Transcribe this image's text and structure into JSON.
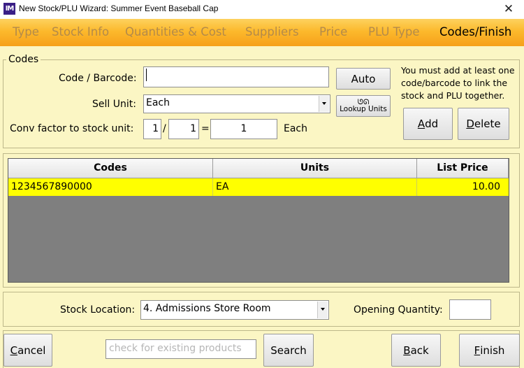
{
  "window": {
    "app_icon": "IM",
    "title": "New Stock/PLU Wizard: Summer Event Baseball Cap",
    "close_glyph": "✕"
  },
  "tabs": [
    {
      "label": "Type",
      "active": false
    },
    {
      "label": "Stock Info",
      "active": false
    },
    {
      "label": "Quantities & Cost",
      "active": false
    },
    {
      "label": "Suppliers",
      "active": false
    },
    {
      "label": "Price",
      "active": false
    },
    {
      "label": "PLU Type",
      "active": false
    },
    {
      "label": "Codes/Finish",
      "active": true
    }
  ],
  "codes": {
    "legend": "Codes",
    "barcode_label": "Code / Barcode:",
    "barcode_value": "",
    "sell_unit_label": "Sell Unit:",
    "sell_unit_value": "Each",
    "conv_label": "Conv factor to stock unit:",
    "conv_num": "1",
    "conv_slash": "/",
    "conv_den": "1",
    "conv_equals": "=",
    "conv_result": "1",
    "conv_unit": "Each",
    "auto_button": "Auto",
    "lookup_units_icon": "glasses-icon",
    "lookup_units_glyph": "ᘎᘏ",
    "lookup_units_button": "Lookup Units",
    "note": "You must add at least one code/barcode to link the stock and PLU together.",
    "add_button": "Add",
    "add_accel": "A",
    "add_rest": "dd",
    "delete_button": "Delete",
    "delete_accel": "D",
    "delete_rest": "elete"
  },
  "grid": {
    "columns": [
      "Codes",
      "Units",
      "List Price"
    ],
    "rows": [
      {
        "code": "1234567890000",
        "unit": "EA",
        "price": "10.00",
        "selected": true
      }
    ],
    "selected_color": "#ffff00"
  },
  "location": {
    "stock_location_label": "Stock Location:",
    "stock_location_value": "4. Admissions Store Room",
    "opening_qty_label": "Opening Quantity:",
    "opening_qty_value": ""
  },
  "footer": {
    "cancel_accel": "C",
    "cancel_rest": "ancel",
    "search_placeholder": "check for existing products",
    "search_button": "Search",
    "back_accel": "B",
    "back_rest": "ack",
    "finish_accel": "F",
    "finish_rest": "inish"
  },
  "colors": {
    "background": "#fbf6c4",
    "tab_gradient_top": "#fdd25f",
    "tab_gradient_bottom": "#f6a01a",
    "inactive_tab": "#b38a4a",
    "grid_background": "#7f7f7f"
  }
}
